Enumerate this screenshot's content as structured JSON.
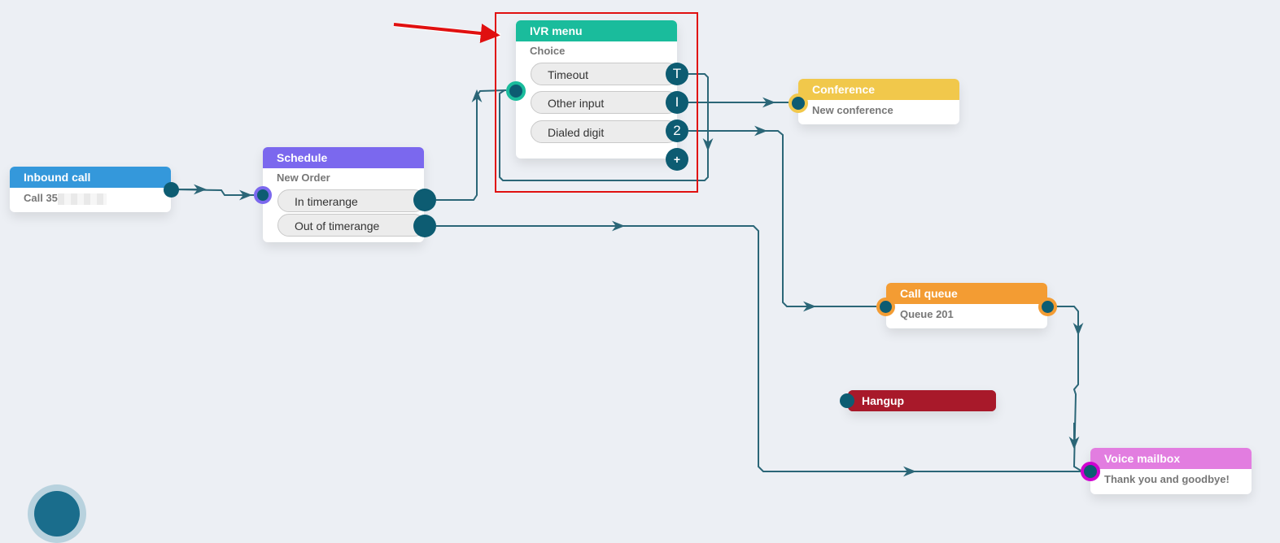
{
  "nodes": {
    "inbound": {
      "title": "Inbound call",
      "subtitle": "Call 35",
      "color": "#3498db"
    },
    "schedule": {
      "title": "Schedule",
      "subtitle": "New Order",
      "color": "#7b68ee",
      "options": [
        "In timerange",
        "Out of timerange"
      ]
    },
    "ivr": {
      "title": "IVR menu",
      "subtitle": "Choice",
      "color": "#1abc9c",
      "options": [
        {
          "label": "Timeout",
          "badge": "T"
        },
        {
          "label": "Other input",
          "badge": "I"
        },
        {
          "label": "Dialed digit",
          "badge": "2"
        }
      ],
      "add_label": "+"
    },
    "conference": {
      "title": "Conference",
      "subtitle": "New conference",
      "color": "#f1c84b"
    },
    "queue": {
      "title": "Call queue",
      "subtitle": "Queue 201",
      "color": "#f39c33"
    },
    "hangup": {
      "title": "Hangup",
      "color": "#a8192a"
    },
    "mailbox": {
      "title": "Voice mailbox",
      "subtitle": "Thank you and goodbye!",
      "color": "#e27de0"
    }
  },
  "colors": {
    "wire": "#2b6677",
    "port": "#0d5c72",
    "highlight": "#e01010",
    "arrow": "#e01010"
  }
}
